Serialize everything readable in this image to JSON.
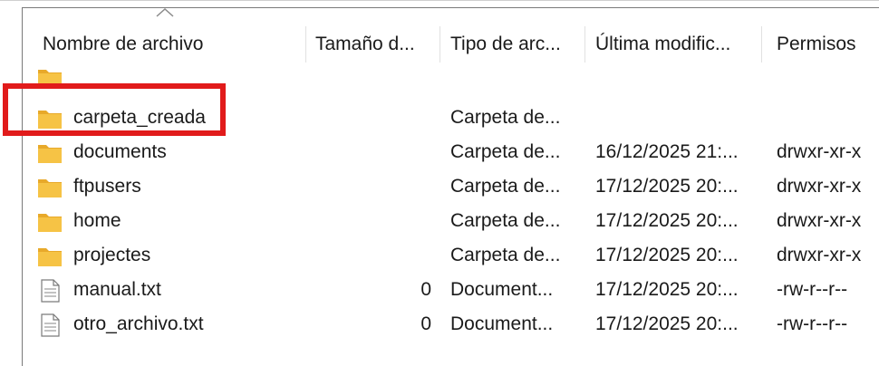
{
  "columns": {
    "name": "Nombre de archivo",
    "size": "Tamaño d...",
    "type": "Tipo de arc...",
    "modified": "Última modific...",
    "perms": "Permisos"
  },
  "files": [
    {
      "name": "",
      "size": "",
      "type": "",
      "modified": "",
      "perms": "",
      "icon": "folder-icon"
    },
    {
      "name": "carpeta_creada",
      "size": "",
      "type": "Carpeta de...",
      "modified": "",
      "perms": "",
      "icon": "folder-icon"
    },
    {
      "name": "documents",
      "size": "",
      "type": "Carpeta de...",
      "modified": "16/12/2025 21:...",
      "perms": "drwxr-xr-x",
      "icon": "folder-icon"
    },
    {
      "name": "ftpusers",
      "size": "",
      "type": "Carpeta de...",
      "modified": "17/12/2025 20:...",
      "perms": "drwxr-xr-x",
      "icon": "folder-icon"
    },
    {
      "name": "home",
      "size": "",
      "type": "Carpeta de...",
      "modified": "17/12/2025 20:...",
      "perms": "drwxr-xr-x",
      "icon": "folder-icon"
    },
    {
      "name": "projectes",
      "size": "",
      "type": "Carpeta de...",
      "modified": "17/12/2025 20:...",
      "perms": "drwxr-xr-x",
      "icon": "folder-icon"
    },
    {
      "name": "manual.txt",
      "size": "0",
      "type": "Document...",
      "modified": "17/12/2025 20:...",
      "perms": "-rw-r--r--",
      "icon": "text-file-icon"
    },
    {
      "name": "otro_archivo.txt",
      "size": "0",
      "type": "Document...",
      "modified": "17/12/2025 20:...",
      "perms": "-rw-r--r--",
      "icon": "text-file-icon"
    }
  ],
  "colors": {
    "highlight": "#e11b1b",
    "folder": "#f6c345"
  }
}
